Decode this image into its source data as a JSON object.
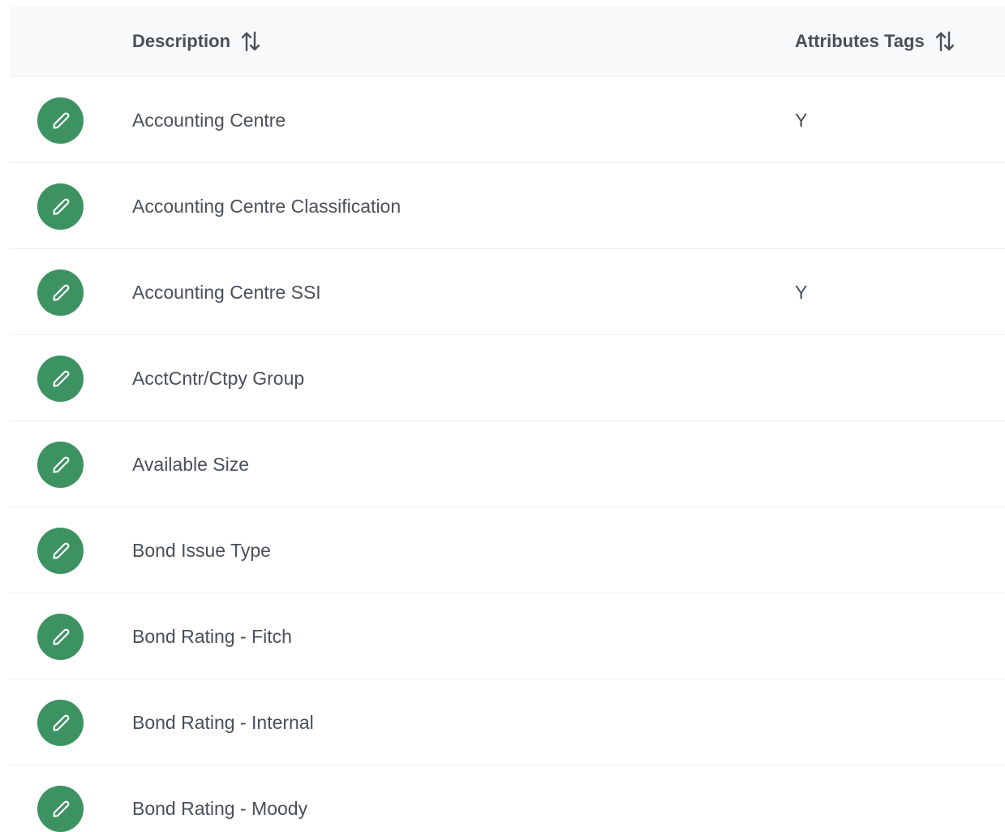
{
  "table": {
    "columns": [
      {
        "label": "Description",
        "sort_icon": "sort-alt-icon"
      },
      {
        "label": "Attributes Tags",
        "sort_icon": "sort-alt-icon"
      }
    ],
    "rows": [
      {
        "description": "Accounting Centre",
        "attributes_tags": "Y"
      },
      {
        "description": "Accounting Centre Classification",
        "attributes_tags": ""
      },
      {
        "description": "Accounting Centre SSI",
        "attributes_tags": "Y"
      },
      {
        "description": "AcctCntr/Ctpy Group",
        "attributes_tags": ""
      },
      {
        "description": "Available Size",
        "attributes_tags": ""
      },
      {
        "description": "Bond Issue Type",
        "attributes_tags": ""
      },
      {
        "description": "Bond Rating - Fitch",
        "attributes_tags": ""
      },
      {
        "description": "Bond Rating - Internal",
        "attributes_tags": ""
      },
      {
        "description": "Bond Rating - Moody",
        "attributes_tags": ""
      }
    ],
    "row_action_icon": "pencil-icon"
  },
  "colors": {
    "edit_button": "#3d9262",
    "header_bg": "#f8f9fa",
    "text": "#495057",
    "row_border": "#e9ecef"
  }
}
